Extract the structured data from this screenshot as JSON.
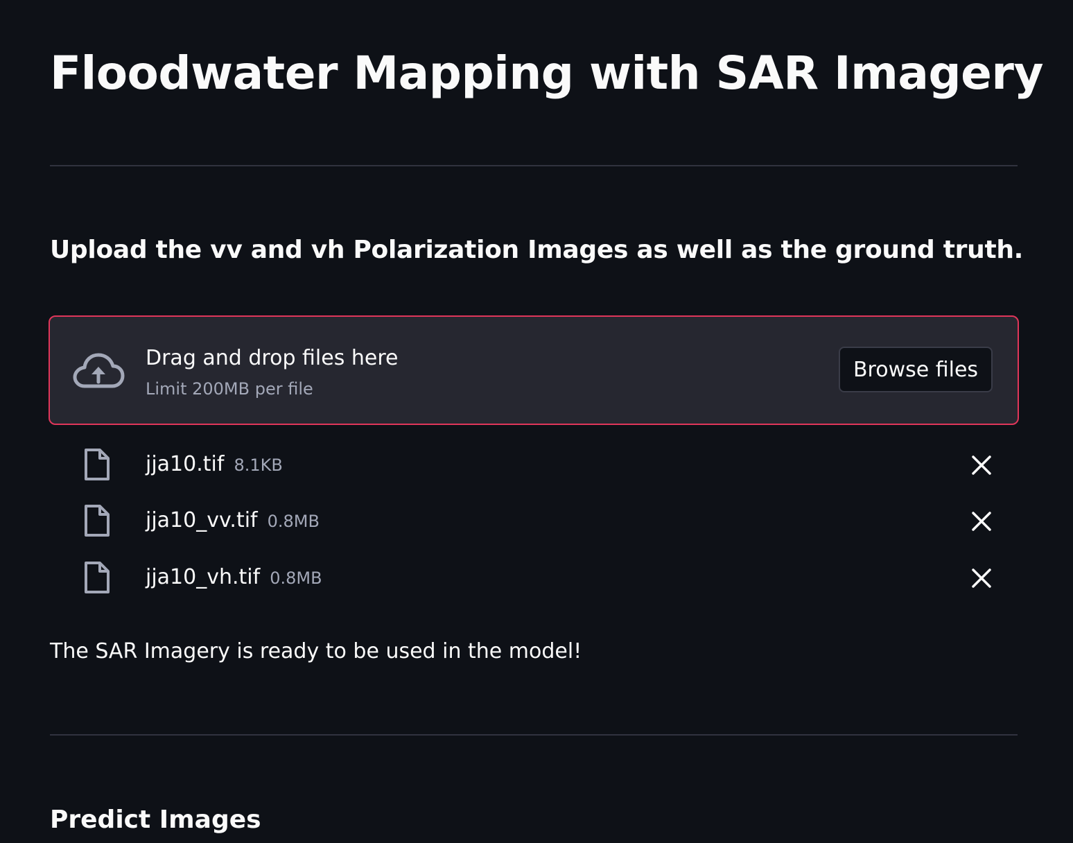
{
  "title": "Floodwater Mapping with SAR Imagery",
  "upload_heading": "Upload the vv and vh Polarization Images as well as the ground truth.",
  "uploader": {
    "drag_text": "Drag and drop files here",
    "limit_text": "Limit 200MB per file",
    "browse_label": "Browse files",
    "border_color": "#e0365a"
  },
  "files": [
    {
      "name": "jja10.tif",
      "size": "8.1KB"
    },
    {
      "name": "jja10_vv.tif",
      "size": "0.8MB"
    },
    {
      "name": "jja10_vh.tif",
      "size": "0.8MB"
    }
  ],
  "status_text": "The SAR Imagery is ready to be used in the model!",
  "predict_heading": "Predict Images",
  "icons": {
    "upload": "cloud-upload-icon",
    "file": "file-icon",
    "remove": "close-icon"
  }
}
